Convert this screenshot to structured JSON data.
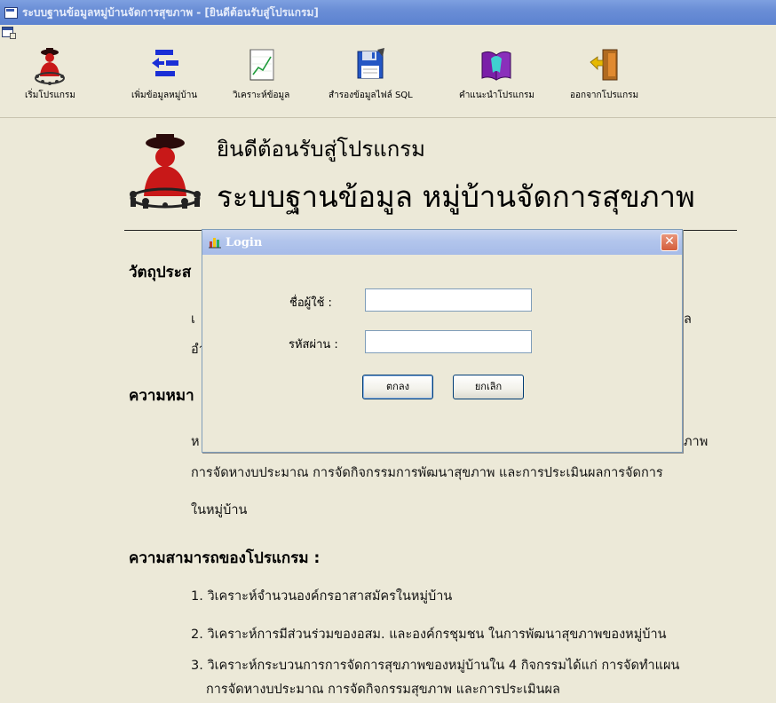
{
  "window": {
    "title": "ระบบฐานข้อมูลหมู่บ้านจัดการสุขภาพ - [ยินดีต้อนรับสู่โปรแกรม]"
  },
  "toolbar": {
    "items": [
      {
        "label": "เริ่มโปรแกรม",
        "icon": "community-person-icon"
      },
      {
        "label": "เพิ่มข้อมูลหมู่บ้าน",
        "icon": "add-data-arrows-icon"
      },
      {
        "label": "วิเคราะห์ข้อมูล",
        "icon": "chart-document-icon"
      },
      {
        "label": "สำรองข้อมูลไฟล์ SQL",
        "icon": "floppy-disk-backup-icon"
      },
      {
        "label": "คำแนะนำโปรแกรม",
        "icon": "help-book-icon"
      },
      {
        "label": "ออกจากโปรแกรม",
        "icon": "exit-door-icon"
      }
    ]
  },
  "welcome": {
    "line1": "ยินดีต้อนรับสู่โปรแกรม",
    "line2": "ระบบฐานข้อมูล หมู่บ้านจัดการสุขภาพ"
  },
  "content": {
    "objective_heading": "วัตถุประส",
    "objective_lines": [
      "เ",
      "อำ"
    ],
    "objective_right": "ล",
    "meaning_heading": "ความหมา",
    "meaning_first": "ห",
    "meaning_right": "ภาพ",
    "meaning_line2": "การจัดหางบประมาณ การจัดกิจกรรมการพัฒนาสุขภาพ และการประเมินผลการจัดการ",
    "meaning_line3": "ในหมู่บ้าน",
    "capability_heading": "ความสามารถของโปรแกรม :",
    "capabilities": [
      "1. วิเคราะห์จำนวนองค์กรอาสาสมัครในหมู่บ้าน",
      "2. วิเคราะห์การมีส่วนร่วมของอสม. และองค์กรชุมชน ในการพัฒนาสุขภาพของหมู่บ้าน",
      "3. วิเคราะห์กระบวนการการจัดการสุขภาพของหมู่บ้านใน 4 กิจกรรมได้แก่ การจัดทำแผน",
      "การจัดหางบประมาณ การจัดกิจกรรมสุขภาพ และการประเมินผล"
    ]
  },
  "login": {
    "title": "Login",
    "close": "✕",
    "username_label": "ชื่อผู้ใช้  :",
    "username_value": "",
    "password_label": "รหัสผ่าน :",
    "password_value": "",
    "ok_label": "ตกลง",
    "cancel_label": "ยกเลิก"
  },
  "colors": {
    "titlebar": "#6a8ed6",
    "dialog_titlebar": "#b2c5ec",
    "close_button": "#d45d3a",
    "background": "#ece9d8"
  }
}
